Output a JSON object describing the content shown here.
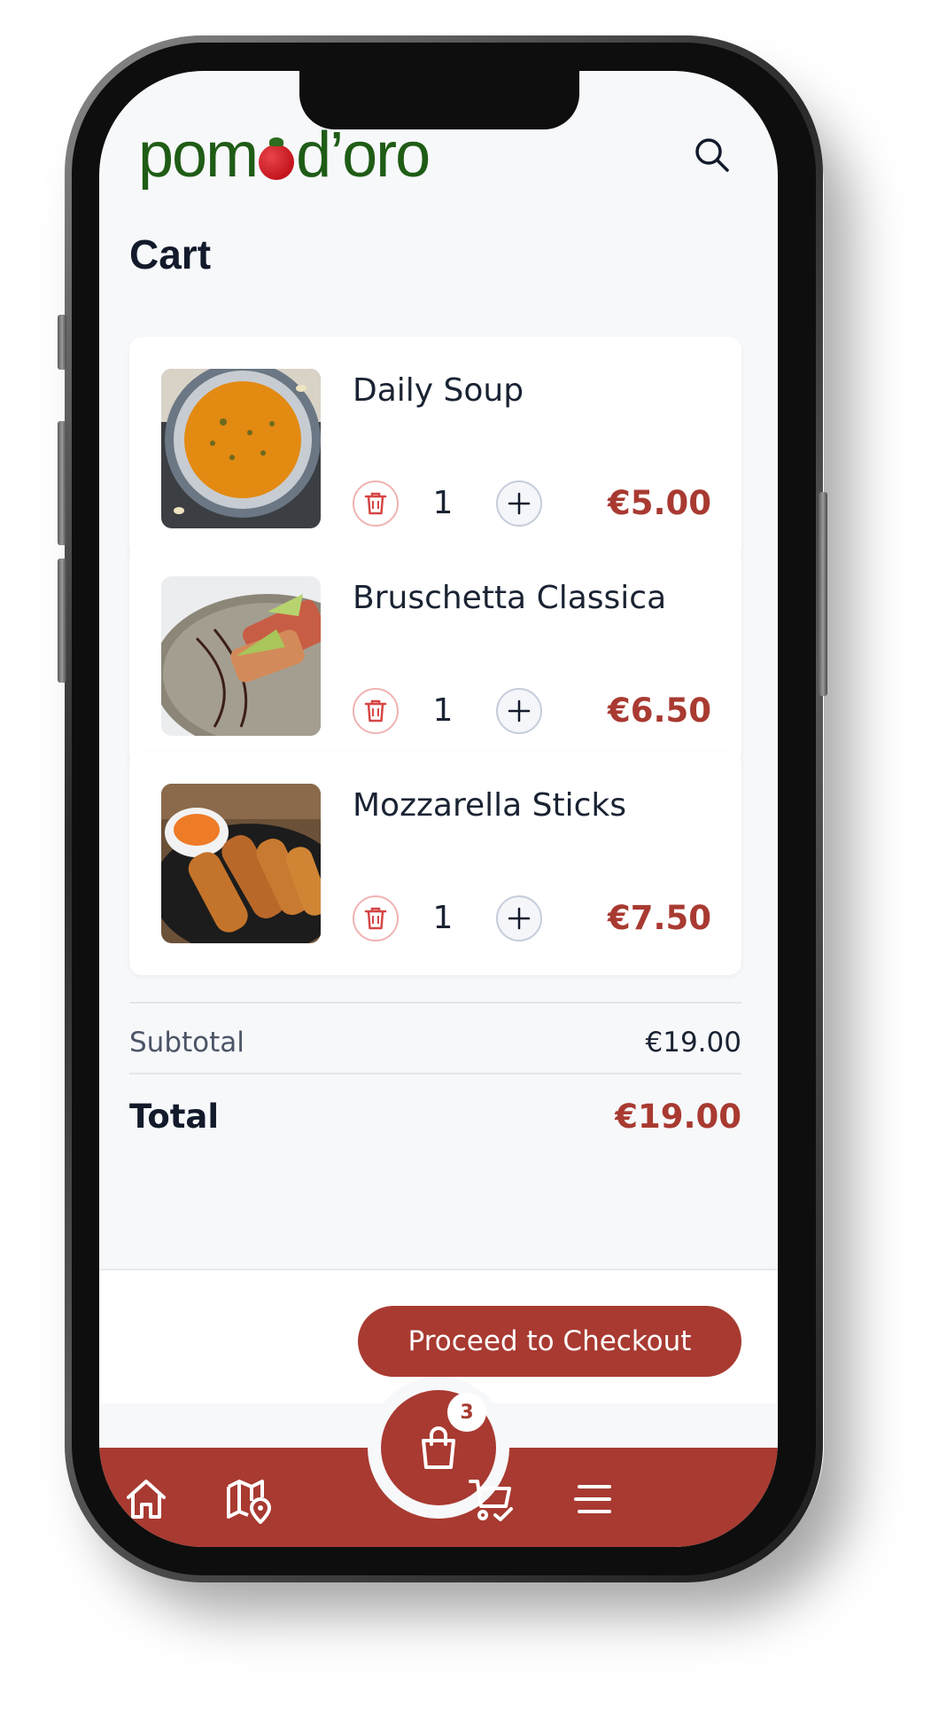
{
  "header": {
    "logo_left": "pom",
    "logo_right": "d’oro",
    "title": "Cart"
  },
  "cart": {
    "items": [
      {
        "name": "Daily Soup",
        "qty": "1",
        "price": "€5.00"
      },
      {
        "name": "Bruschetta Classica",
        "qty": "1",
        "price": "€6.50"
      },
      {
        "name": "Mozzarella Sticks",
        "qty": "1",
        "price": "€7.50"
      }
    ]
  },
  "summary": {
    "subtotal_label": "Subtotal",
    "subtotal_value": "€19.00",
    "total_label": "Total",
    "total_value": "€19.00"
  },
  "checkout": {
    "label": "Proceed to Checkout"
  },
  "nav": {
    "badge_count": "3",
    "items": [
      "home-icon",
      "map-pin-icon",
      "shopping-bag-icon",
      "cart-check-icon",
      "menu-icon"
    ]
  },
  "colors": {
    "brand": "#a83a31",
    "logo_green": "#1f5c16",
    "background": "#f7f8fa"
  }
}
